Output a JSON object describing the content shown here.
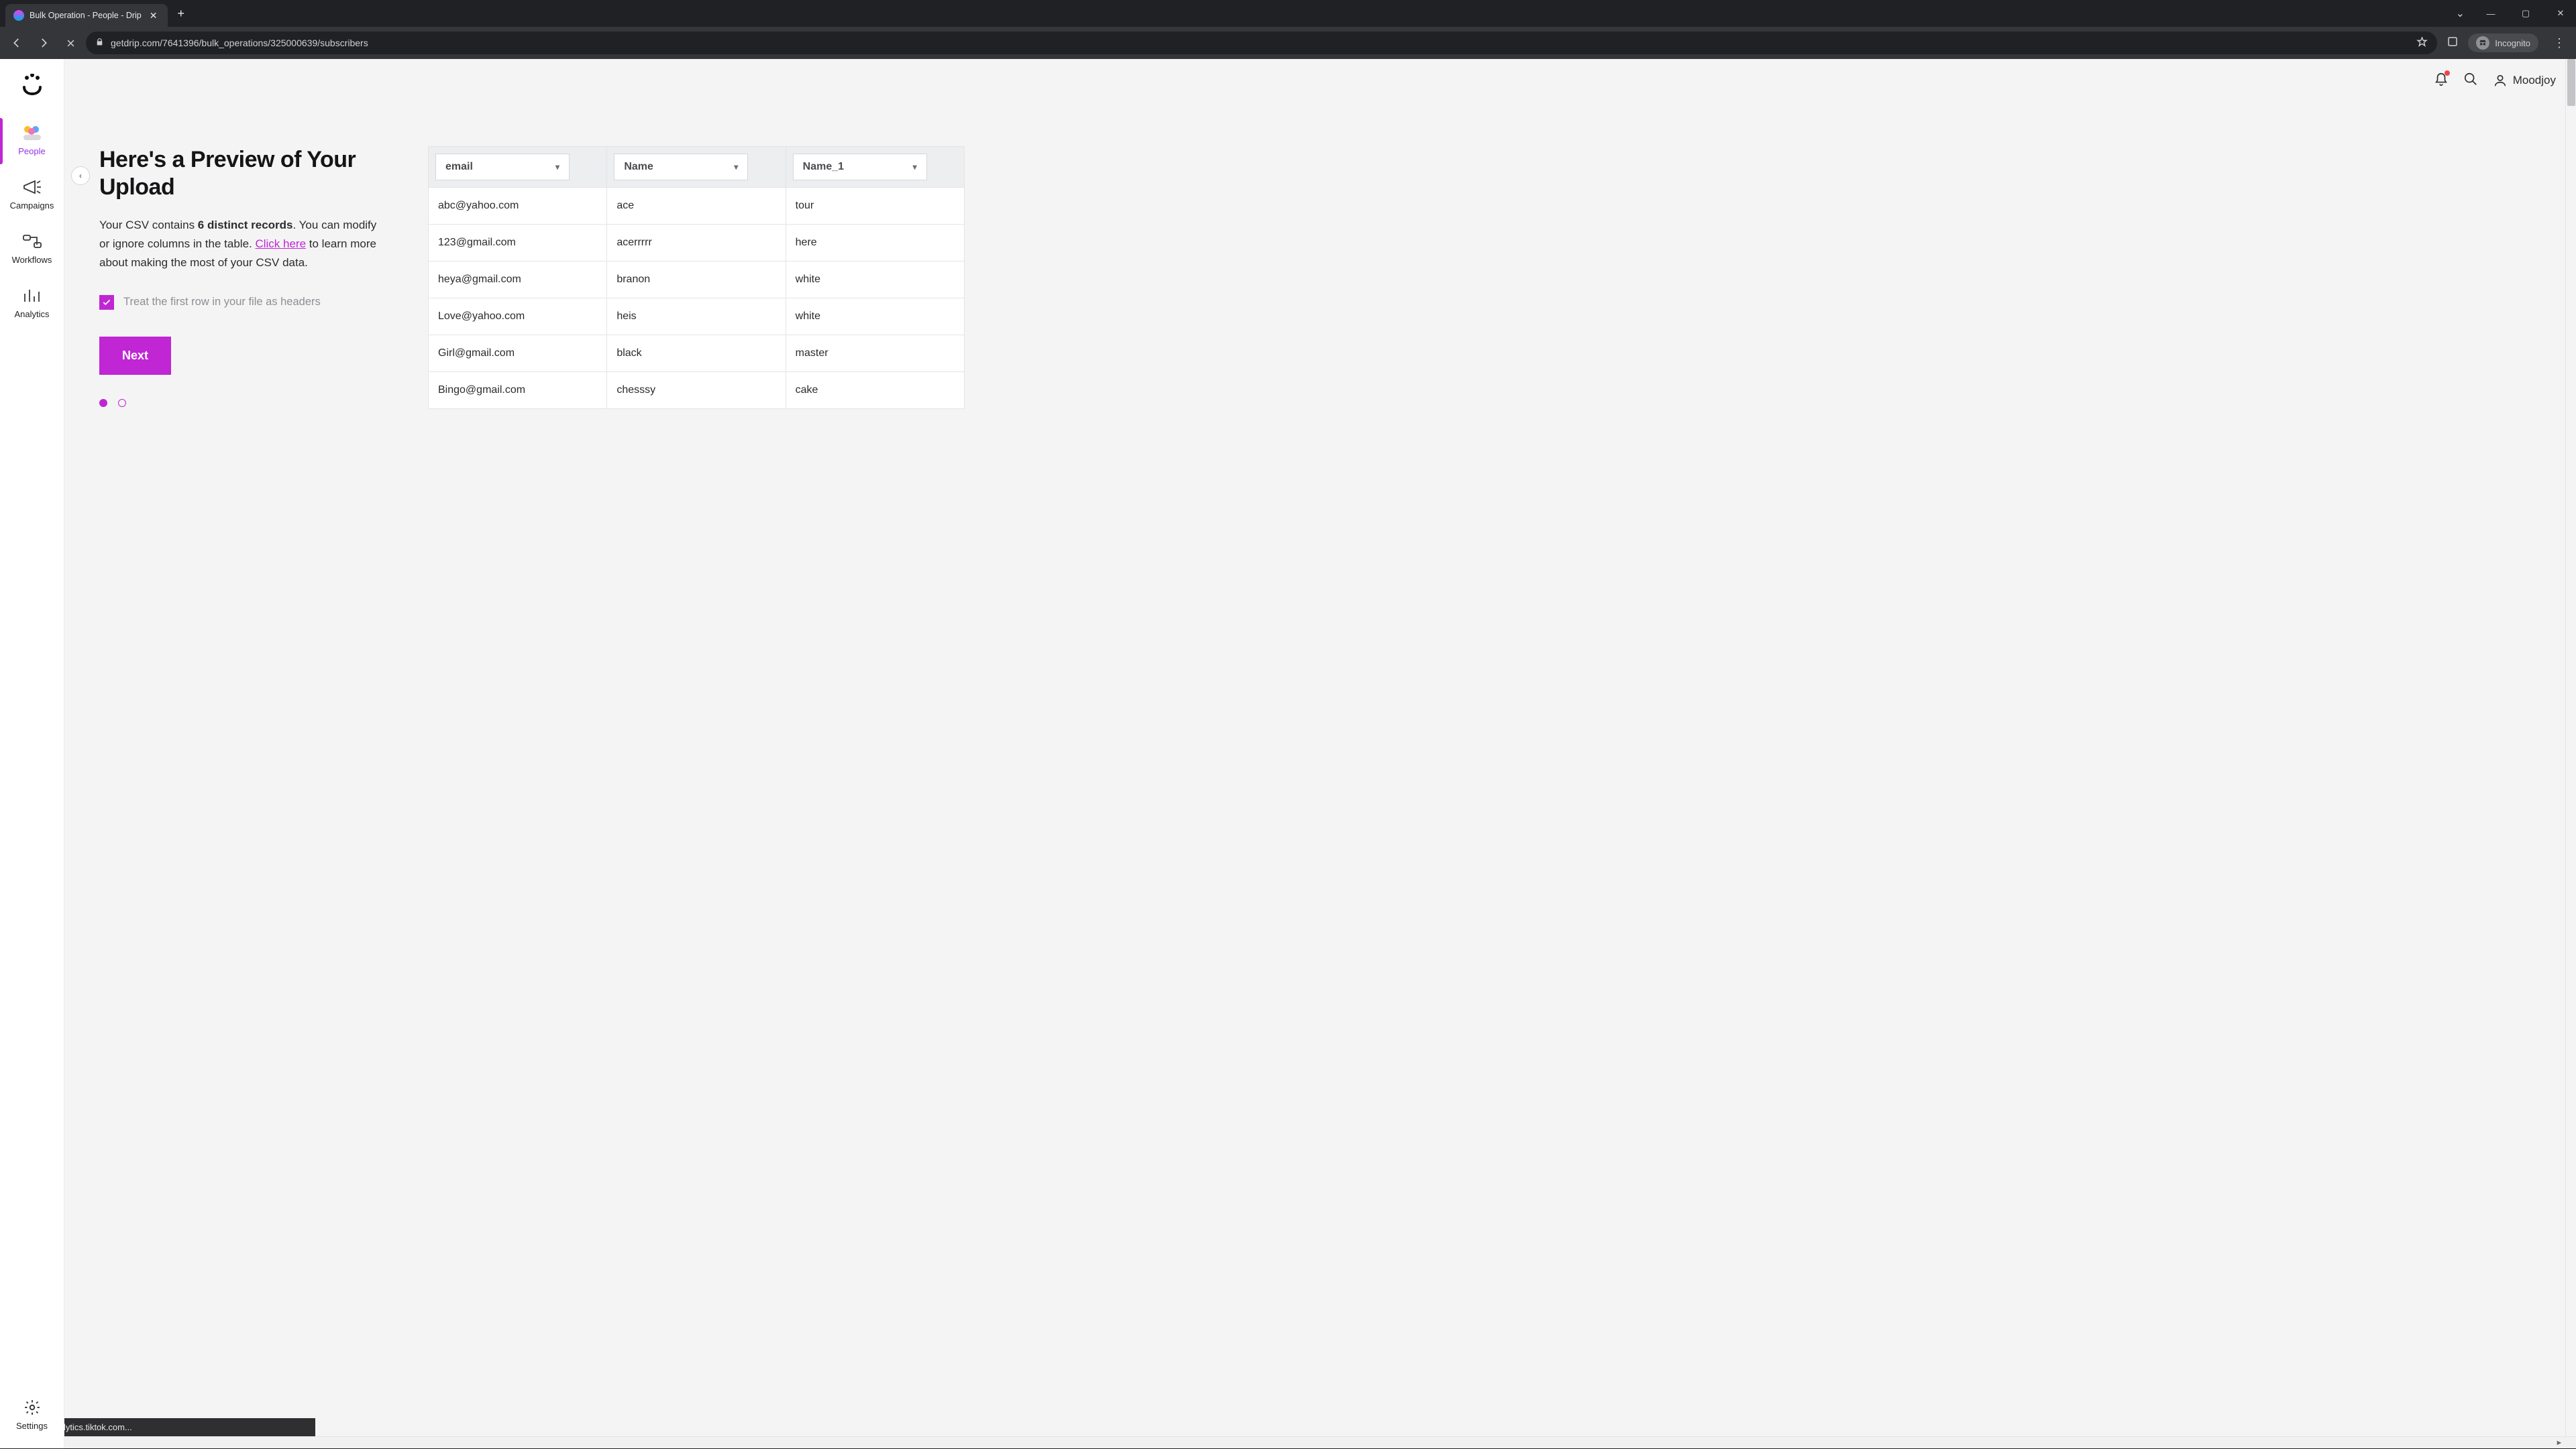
{
  "browser": {
    "tab_title": "Bulk Operation - People - Drip",
    "url": "getdrip.com/7641396/bulk_operations/325000639/subscribers",
    "incognito_label": "Incognito",
    "status_text": "Waiting for analytics.tiktok.com..."
  },
  "sidebar": {
    "items": [
      {
        "label": "People",
        "active": true
      },
      {
        "label": "Campaigns",
        "active": false
      },
      {
        "label": "Workflows",
        "active": false
      },
      {
        "label": "Analytics",
        "active": false
      }
    ],
    "settings_label": "Settings"
  },
  "header": {
    "username": "Moodjoy"
  },
  "upload_preview": {
    "title": "Here's a Preview of Your Upload",
    "desc_prefix": "Your CSV contains ",
    "desc_strong": "6 distinct records",
    "desc_mid": ". You can modify or ignore columns in the table. ",
    "link_text": "Click here",
    "desc_suffix": " to learn more about making the most of your CSV data.",
    "checkbox_label": "Treat the first row in your file as headers",
    "next_label": "Next",
    "step_current": 1,
    "step_total": 2
  },
  "table": {
    "columns": [
      {
        "selected": "email"
      },
      {
        "selected": "Name"
      },
      {
        "selected": "Name_1"
      }
    ],
    "rows": [
      {
        "c0": "abc@yahoo.com",
        "c1": "ace",
        "c2": "tour"
      },
      {
        "c0": "123@gmail.com",
        "c1": "acerrrrr",
        "c2": "here"
      },
      {
        "c0": "heya@gmail.com",
        "c1": "branon",
        "c2": "white"
      },
      {
        "c0": "Love@yahoo.com",
        "c1": "heis",
        "c2": "white"
      },
      {
        "c0": "Girl@gmail.com",
        "c1": "black",
        "c2": "master"
      },
      {
        "c0": "Bingo@gmail.com",
        "c1": "chesssy",
        "c2": "cake"
      }
    ]
  }
}
